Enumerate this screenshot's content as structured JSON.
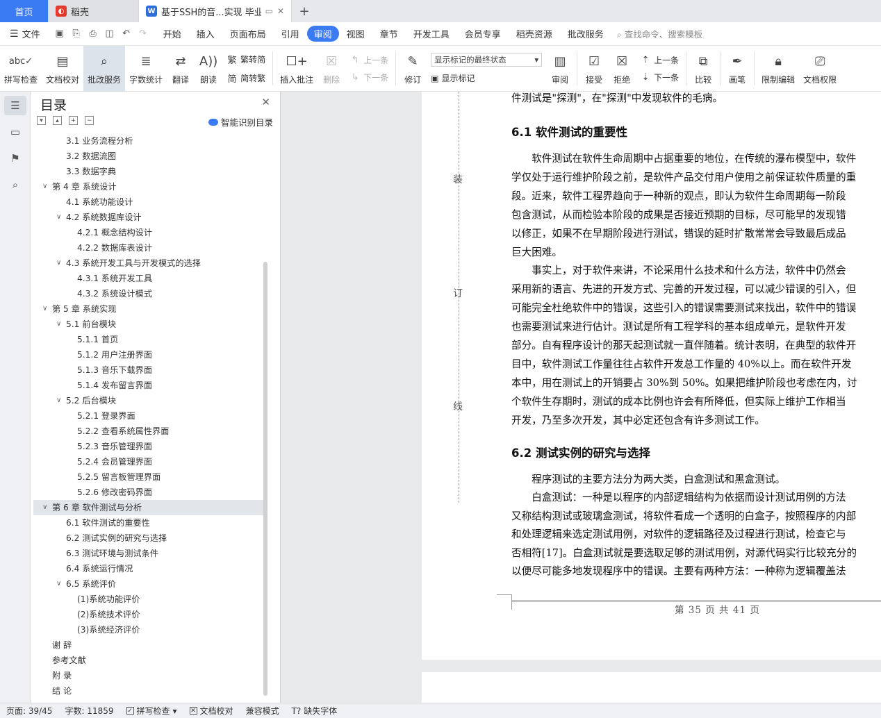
{
  "tabs": {
    "home": "首页",
    "daoke": "稻壳",
    "doc": "基于SSH的音...实现 毕业论文"
  },
  "menubar": {
    "file": "文件",
    "items": [
      "开始",
      "插入",
      "页面布局",
      "引用",
      "审阅",
      "视图",
      "章节",
      "开发工具",
      "会员专享",
      "稻壳资源",
      "批改服务"
    ],
    "active": "审阅",
    "search": "查找命令、搜索模板"
  },
  "ribbon": {
    "spell": "拼写检查",
    "doccheck": "文档校对",
    "review_service": "批改服务",
    "wordcount": "字数统计",
    "translate": "翻译",
    "read": "朗读",
    "to_trad": "繁转简",
    "to_simp": "简转繁",
    "insert_comment": "插入批注",
    "delete": "删除",
    "prev": "上一条",
    "next": "下一条",
    "track": "修订",
    "markup_state": "显示标记的最终状态",
    "show_markup": "显示标记",
    "review": "审阅",
    "accept": "接受",
    "reject": "拒绝",
    "prev2": "上一条",
    "next2": "下一条",
    "compare": "比较",
    "pen": "画笔",
    "restrict": "限制编辑",
    "rights": "文档权限"
  },
  "toc": {
    "title": "目录",
    "smart": "智能识别目录",
    "items": [
      {
        "text": "3.1  业务流程分析",
        "level": 2
      },
      {
        "text": "3.2  数据流图",
        "level": 2
      },
      {
        "text": "3.3  数据字典",
        "level": 2
      },
      {
        "text": "第 4 章  系统设计",
        "level": 1,
        "chev": true
      },
      {
        "text": "4.1  系统功能设计",
        "level": 2
      },
      {
        "text": "4.2  系统数据库设计",
        "level": 2,
        "chev": true
      },
      {
        "text": "4.2.1  概念结构设计",
        "level": 3
      },
      {
        "text": "4.2.2  数据库表设计",
        "level": 3
      },
      {
        "text": "4.3  系统开发工具与开发模式的选择",
        "level": 2,
        "chev": true
      },
      {
        "text": "4.3.1  系统开发工具",
        "level": 3
      },
      {
        "text": "4.3.2  系统设计模式",
        "level": 3
      },
      {
        "text": "第 5 章  系统实现",
        "level": 1,
        "chev": true
      },
      {
        "text": "5.1  前台模块",
        "level": 2,
        "chev": true
      },
      {
        "text": "5.1.1  首页",
        "level": 3
      },
      {
        "text": "5.1.2  用户注册界面",
        "level": 3
      },
      {
        "text": "5.1.3  音乐下载界面",
        "level": 3
      },
      {
        "text": "5.1.4  发布留言界面",
        "level": 3
      },
      {
        "text": "5.2  后台模块",
        "level": 2,
        "chev": true
      },
      {
        "text": "5.2.1  登录界面",
        "level": 3
      },
      {
        "text": "5.2.2  查看系统属性界面",
        "level": 3
      },
      {
        "text": "5.2.3  音乐管理界面",
        "level": 3
      },
      {
        "text": "5.2.4  会员管理界面",
        "level": 3
      },
      {
        "text": "5.2.5  留言板管理界面",
        "level": 3
      },
      {
        "text": "5.2.6  修改密码界面",
        "level": 3
      },
      {
        "text": "第 6 章  软件测试与分析",
        "level": 1,
        "chev": true,
        "selected": true
      },
      {
        "text": "6.1  软件测试的重要性",
        "level": 2
      },
      {
        "text": "6.2  测试实例的研究与选择",
        "level": 2
      },
      {
        "text": "6.3  测试环境与测试条件",
        "level": 2
      },
      {
        "text": "6.4  系统运行情况",
        "level": 2
      },
      {
        "text": "6.5  系统评价",
        "level": 2,
        "chev": true
      },
      {
        "text": "(1)系统功能评价",
        "level": 3
      },
      {
        "text": "(2)系统技术评价",
        "level": 3
      },
      {
        "text": "(3)系统经济评价",
        "level": 3
      },
      {
        "text": "谢    辞",
        "level": 1
      },
      {
        "text": "参考文献",
        "level": 1
      },
      {
        "text": "附    录",
        "level": 1
      },
      {
        "text": "结    论",
        "level": 1
      }
    ]
  },
  "doc": {
    "binding": [
      "装",
      "订",
      "线"
    ],
    "line0": "件测试是\"探测\"，在\"探测\"中发现软件的毛病。",
    "h1": "6.1  软件测试的重要性",
    "p1": [
      "　　软件测试在软件生命周期中占据重要的地位，在传统的瀑布模型中，软件",
      "学仅处于运行维护阶段之前，是软件产品交付用户使用之前保证软件质量的重",
      "段。近来，软件工程界趋向于一种新的观点，即认为软件生命周期每一阶段",
      "包含测试，从而检验本阶段的成果是否接近预期的目标，尽可能早的发现错",
      "以修正，如果不在早期阶段进行测试，错误的延时扩散常常会导致最后成品",
      "巨大困难。",
      "　　事实上，对于软件来讲，不论采用什么技术和什么方法，软件中仍然会",
      "采用新的语言、先进的开发方式、完善的开发过程，可以减少错误的引入，但",
      "可能完全杜绝软件中的错误，这些引入的错误需要测试来找出，软件中的错误",
      "也需要测试来进行估计。测试是所有工程学科的基本组成单元，是软件开发",
      "部分。自有程序设计的那天起测试就一直伴随着。统计表明，在典型的软件开",
      "目中，软件测试工作量往往占软件开发总工作量的 40%以上。而在软件开发",
      "本中，用在测试上的开销要占 30%到 50%。如果把维护阶段也考虑在内，讨",
      "个软件生存期时，测试的成本比例也许会有所降低，但实际上维护工作相当",
      "开发，乃至多次开发，其中必定还包含有许多测试工作。"
    ],
    "h2": "6.2  测试实例的研究与选择",
    "p2": [
      "　　程序测试的主要方法分为两大类，白盒测试和黑盒测试。",
      "　　白盒测试：一种是以程序的内部逻辑结构为依据而设计测试用例的方法",
      "又称结构测试或玻璃盒测试，将软件看成一个透明的白盒子，按照程序的内部",
      "和处理逻辑来选定测试用例，对软件的逻辑路径及过程进行测试，检查它与",
      "否相符[17]。白盒测试就是要选取足够的测试用例，对源代码实行比较充分的",
      "以便尽可能多地发现程序中的错误。主要有两种方法：一种称为逻辑覆盖法"
    ],
    "footer": "第 35 页 共 41 页"
  },
  "status": {
    "page": "页面: 39/45",
    "words": "字数: 11859",
    "spell": "拼写检查",
    "doccheck": "文档校对",
    "compat": "兼容模式",
    "missing_font": "缺失字体"
  }
}
